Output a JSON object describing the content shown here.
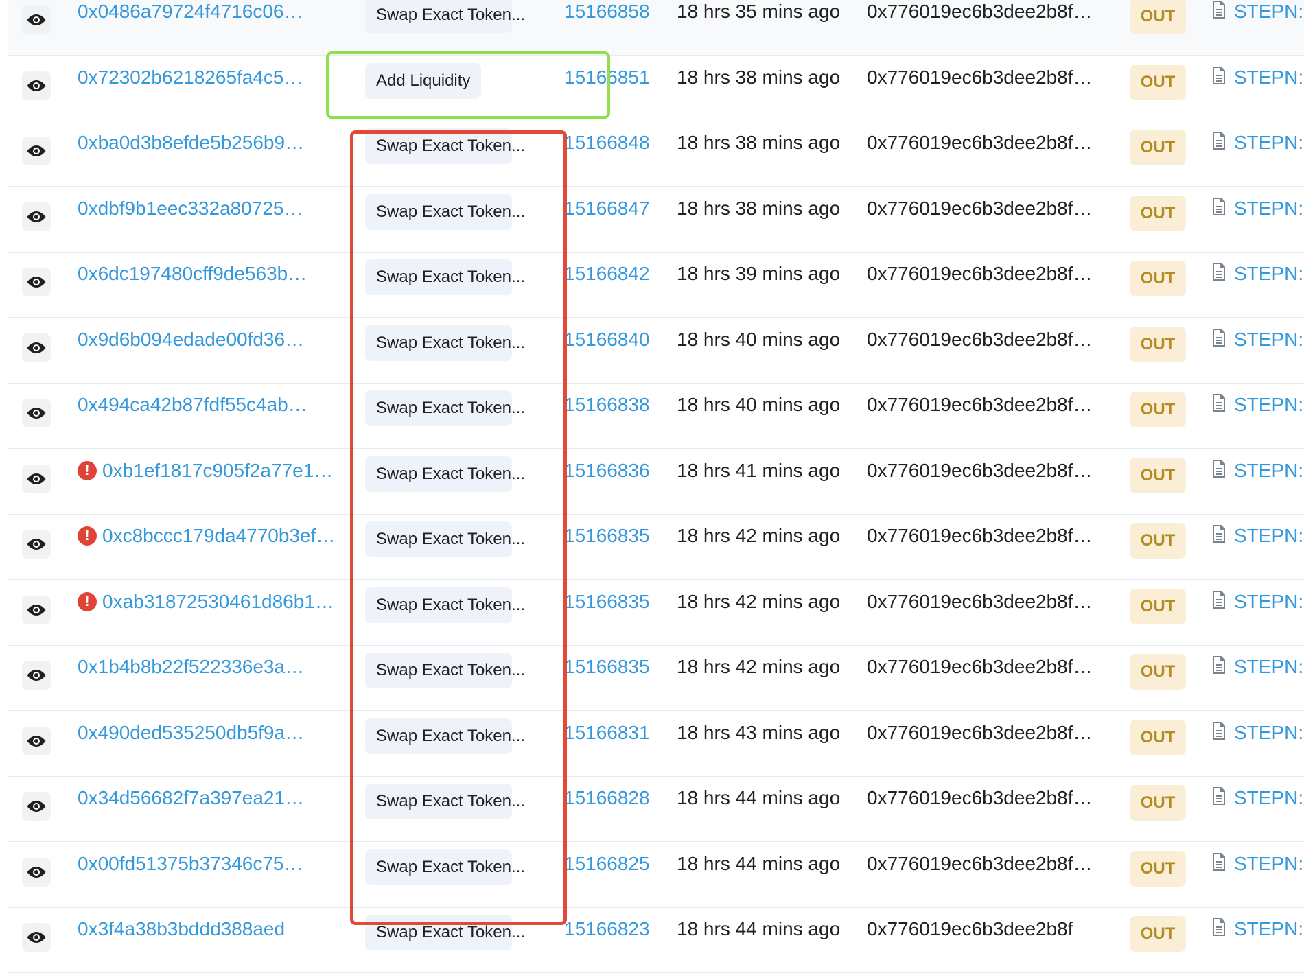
{
  "table": {
    "rows": [
      {
        "hash": "0x0486a79724f4716c06…",
        "error": false,
        "method": "Swap Exact Token...",
        "block": "15166858",
        "age": "18 hrs 35 mins ago",
        "from": "0x776019ec6b3dee2b8f…",
        "direction": "OUT",
        "to": "STEPN:"
      },
      {
        "hash": "0x72302b6218265fa4c5…",
        "error": false,
        "method": "Add Liquidity",
        "block": "15166851",
        "age": "18 hrs 38 mins ago",
        "from": "0x776019ec6b3dee2b8f…",
        "direction": "OUT",
        "to": "STEPN:"
      },
      {
        "hash": "0xba0d3b8efde5b256b9…",
        "error": false,
        "method": "Swap Exact Token...",
        "block": "15166848",
        "age": "18 hrs 38 mins ago",
        "from": "0x776019ec6b3dee2b8f…",
        "direction": "OUT",
        "to": "STEPN:"
      },
      {
        "hash": "0xdbf9b1eec332a80725…",
        "error": false,
        "method": "Swap Exact Token...",
        "block": "15166847",
        "age": "18 hrs 38 mins ago",
        "from": "0x776019ec6b3dee2b8f…",
        "direction": "OUT",
        "to": "STEPN:"
      },
      {
        "hash": "0x6dc197480cff9de563b…",
        "error": false,
        "method": "Swap Exact Token...",
        "block": "15166842",
        "age": "18 hrs 39 mins ago",
        "from": "0x776019ec6b3dee2b8f…",
        "direction": "OUT",
        "to": "STEPN:"
      },
      {
        "hash": "0x9d6b094edade00fd36…",
        "error": false,
        "method": "Swap Exact Token...",
        "block": "15166840",
        "age": "18 hrs 40 mins ago",
        "from": "0x776019ec6b3dee2b8f…",
        "direction": "OUT",
        "to": "STEPN:"
      },
      {
        "hash": "0x494ca42b87fdf55c4ab…",
        "error": false,
        "method": "Swap Exact Token...",
        "block": "15166838",
        "age": "18 hrs 40 mins ago",
        "from": "0x776019ec6b3dee2b8f…",
        "direction": "OUT",
        "to": "STEPN:"
      },
      {
        "hash": "0xb1ef1817c905f2a77e1…",
        "error": true,
        "method": "Swap Exact Token...",
        "block": "15166836",
        "age": "18 hrs 41 mins ago",
        "from": "0x776019ec6b3dee2b8f…",
        "direction": "OUT",
        "to": "STEPN:"
      },
      {
        "hash": "0xc8bccc179da4770b3ef…",
        "error": true,
        "method": "Swap Exact Token...",
        "block": "15166835",
        "age": "18 hrs 42 mins ago",
        "from": "0x776019ec6b3dee2b8f…",
        "direction": "OUT",
        "to": "STEPN:"
      },
      {
        "hash": "0xab31872530461d86b1…",
        "error": true,
        "method": "Swap Exact Token...",
        "block": "15166835",
        "age": "18 hrs 42 mins ago",
        "from": "0x776019ec6b3dee2b8f…",
        "direction": "OUT",
        "to": "STEPN:"
      },
      {
        "hash": "0x1b4b8b22f522336e3a…",
        "error": false,
        "method": "Swap Exact Token...",
        "block": "15166835",
        "age": "18 hrs 42 mins ago",
        "from": "0x776019ec6b3dee2b8f…",
        "direction": "OUT",
        "to": "STEPN:"
      },
      {
        "hash": "0x490ded535250db5f9a…",
        "error": false,
        "method": "Swap Exact Token...",
        "block": "15166831",
        "age": "18 hrs 43 mins ago",
        "from": "0x776019ec6b3dee2b8f…",
        "direction": "OUT",
        "to": "STEPN:"
      },
      {
        "hash": "0x34d56682f7a397ea21…",
        "error": false,
        "method": "Swap Exact Token...",
        "block": "15166828",
        "age": "18 hrs 44 mins ago",
        "from": "0x776019ec6b3dee2b8f…",
        "direction": "OUT",
        "to": "STEPN:"
      },
      {
        "hash": "0x00fd51375b37346c75…",
        "error": false,
        "method": "Swap Exact Token...",
        "block": "15166825",
        "age": "18 hrs 44 mins ago",
        "from": "0x776019ec6b3dee2b8f…",
        "direction": "OUT",
        "to": "STEPN:"
      },
      {
        "hash": "0x3f4a38b3bddd388aed",
        "error": false,
        "method": "Swap Exact Token...",
        "block": "15166823",
        "age": "18 hrs 44 mins ago",
        "from": "0x776019ec6b3dee2b8f",
        "direction": "OUT",
        "to": "STEPN:"
      }
    ]
  },
  "icons": {
    "view": "eye-icon",
    "failed": "exclamation-circle-icon",
    "contract": "document-icon"
  },
  "colors": {
    "link": "#3498db",
    "out_badge_bg": "#fbeed7",
    "out_badge_text": "#b48b25",
    "error": "#de4437",
    "highlight_green": "#8ee04f",
    "highlight_red": "#e04a36"
  }
}
